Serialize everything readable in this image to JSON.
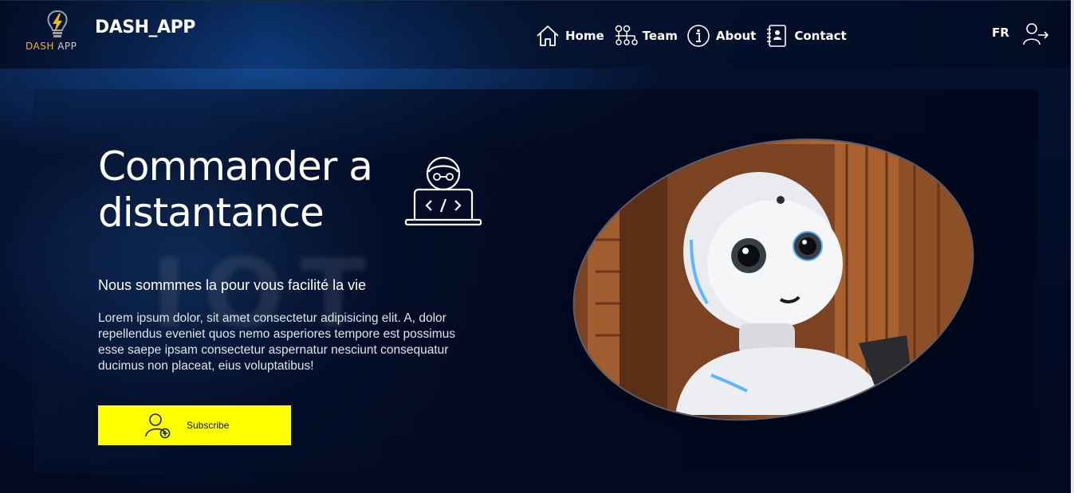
{
  "header": {
    "logo": {
      "main": "DASH",
      "sub": "APP",
      "icon": "lightning-bulb-icon"
    },
    "app_title": "DASH_APP",
    "nav": [
      {
        "label": "Home",
        "icon": "home-icon"
      },
      {
        "label": "Team",
        "icon": "team-network-icon"
      },
      {
        "label": "About",
        "icon": "info-icon"
      },
      {
        "label": "Contact",
        "icon": "contact-book-icon"
      }
    ],
    "language": "FR",
    "logout_icon": "logout-icon"
  },
  "hero": {
    "title_line1": "Commander a",
    "title_line2": "distantance",
    "subtitle": "Nous sommmes la pour vous facilité la vie",
    "paragraph": "Lorem ipsum dolor, sit amet consectetur adipisicing elit. A, dolor repellendus eveniet quos nemo asperiores tempore est possimus esse saepe ipsam consectetur aspernatur nesciunt consequatur ducimus non placeat, eius voluptatibus!",
    "subscribe_label": "Subscribe",
    "background_text": "IOT",
    "coder_icon": "coder-laptop-icon",
    "image": "robot-photo"
  },
  "colors": {
    "accent": "#ffff00",
    "logo_yellow": "#f3b619",
    "background": "#02081f"
  }
}
